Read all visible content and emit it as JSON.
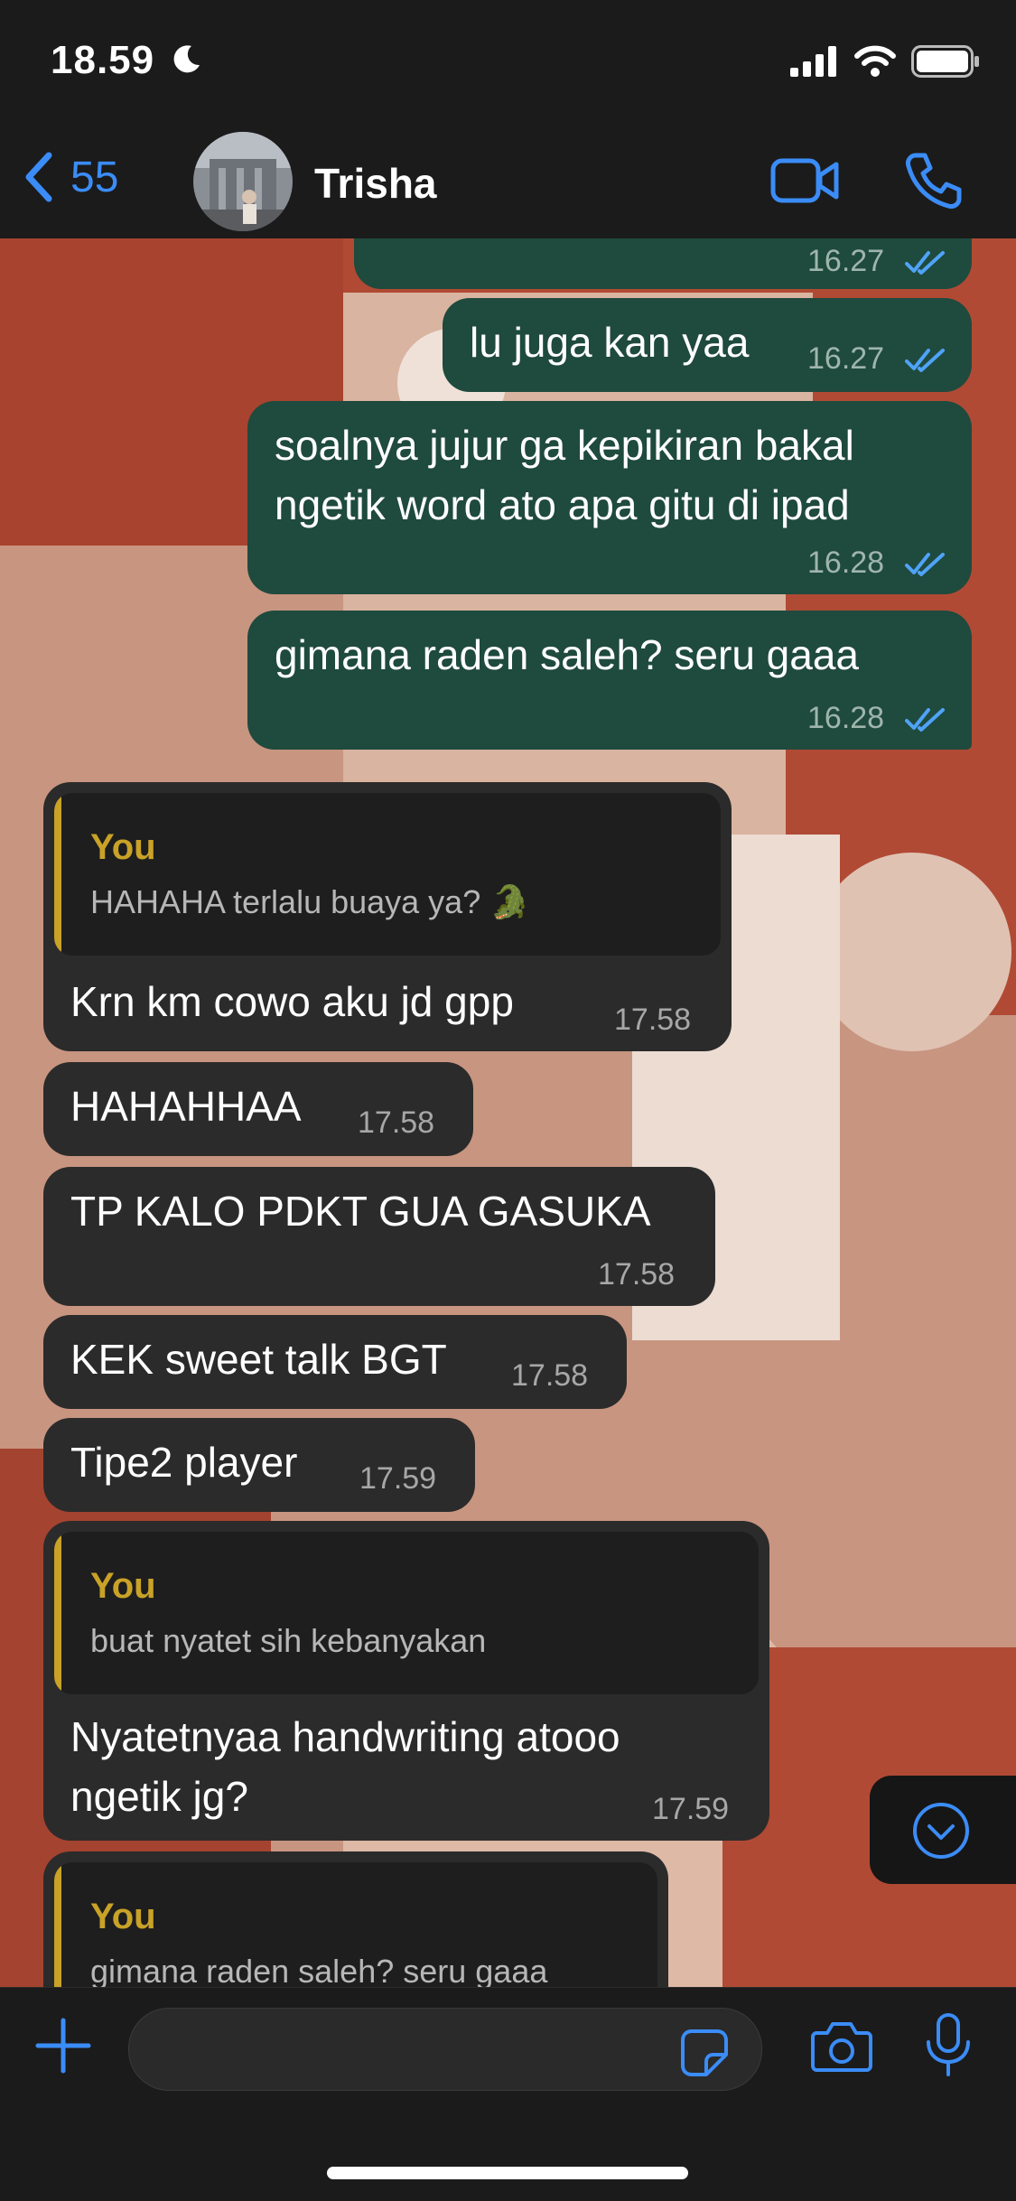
{
  "status_bar": {
    "time": "18.59"
  },
  "nav": {
    "back_count": "55",
    "contact_name": "Trisha"
  },
  "messages": {
    "m0_time": "16.27",
    "m1_text": "lu juga kan yaa",
    "m1_time": "16.27",
    "m2_line1": "soalnya jujur ga kepikiran bakal",
    "m2_line2": "ngetik word ato apa gitu di ipad",
    "m2_time": "16.28",
    "m3_text": "gimana raden saleh? seru gaaa",
    "m3_time": "16.28",
    "m4_quote_author": "You",
    "m4_quote_text": "HAHAHA terlalu buaya ya? 🐊",
    "m4_text": "Krn km cowo aku jd gpp",
    "m4_time": "17.58",
    "m5_text": "HAHAHHAA",
    "m5_time": "17.58",
    "m6_text": "TP KALO PDKT GUA GASUKA",
    "m6_time": "17.58",
    "m7_text": "KEK sweet talk BGT",
    "m7_time": "17.58",
    "m8_text": "Tipe2 player",
    "m8_time": "17.59",
    "m9_quote_author": "You",
    "m9_quote_text": "buat nyatet sih kebanyakan",
    "m9_line1": "Nyatetnyaa handwriting atooo",
    "m9_line2": "ngetik jg?",
    "m9_time": "17.59",
    "m10_quote_author": "You",
    "m10_quote_text": "gimana raden saleh? seru gaaa"
  },
  "colors": {
    "accent": "#3b8cf6",
    "outgoing": "#1f4a3e",
    "incoming": "#2b2b2b",
    "quote_accent": "#c9a227",
    "wallpaper": "#b04a34"
  }
}
